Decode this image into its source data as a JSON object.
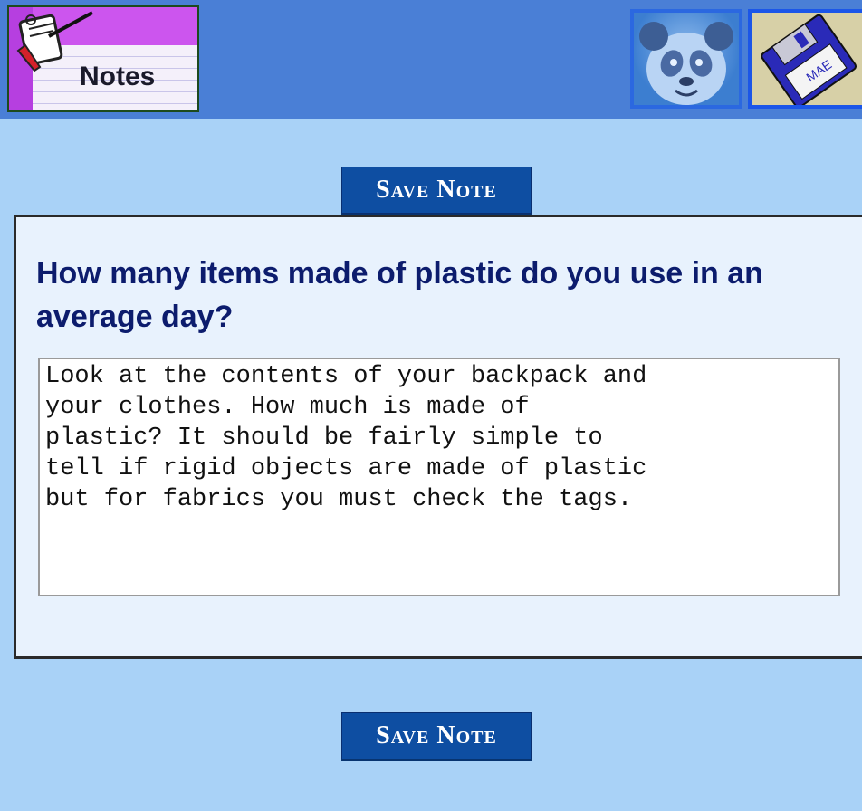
{
  "header": {
    "notes_label": "Notes",
    "icons": [
      "notepad-icon",
      "panda-icon",
      "floppy-disk-icon"
    ]
  },
  "buttons": {
    "save_top": "Save Note",
    "save_bottom": "Save Note"
  },
  "note": {
    "question": "How many items made of plastic do you use in an average day?",
    "text": "Look at the contents of your backpack and\nyour clothes. How much is made of\nplastic? It should be fairly simple to\ntell if rigid objects are made of plastic\nbut for fabrics you must check the tags."
  },
  "colors": {
    "page_bg": "#a9d2f7",
    "topbar": "#4a7fd6",
    "button": "#0e4ea2",
    "question_text": "#0c1c6d"
  }
}
